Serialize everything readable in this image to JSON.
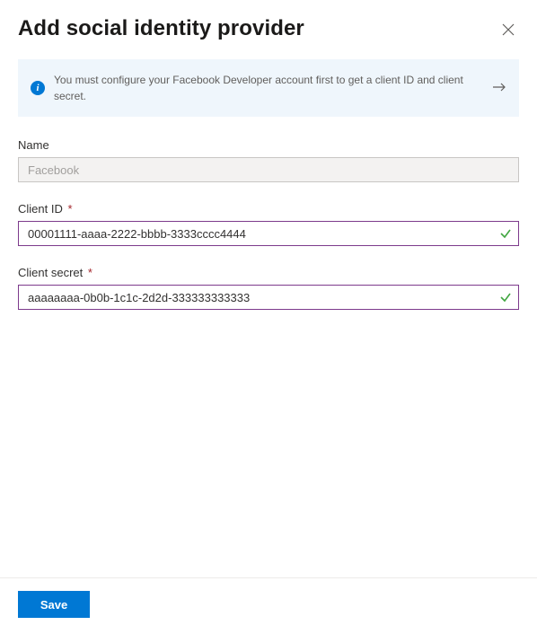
{
  "header": {
    "title": "Add social identity provider"
  },
  "info": {
    "text": "You must configure your Facebook Developer account first to get a client ID and client secret."
  },
  "fields": {
    "name": {
      "label": "Name",
      "value": "Facebook",
      "required": false,
      "disabled": true
    },
    "client_id": {
      "label": "Client ID",
      "value": "00001111-aaaa-2222-bbbb-3333cccc4444",
      "required_marker": "*",
      "valid": true
    },
    "client_secret": {
      "label": "Client secret",
      "value": "aaaaaaaa-0b0b-1c1c-2d2d-333333333333",
      "required_marker": "*",
      "valid": true
    }
  },
  "footer": {
    "save_label": "Save"
  }
}
